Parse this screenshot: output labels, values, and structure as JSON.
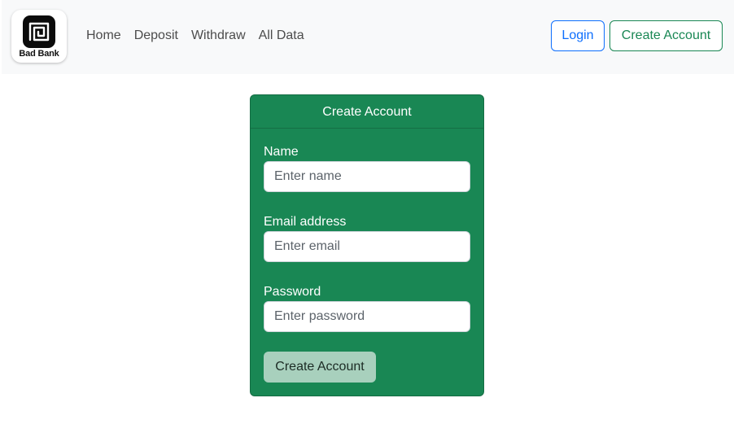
{
  "navbar": {
    "logo": {
      "text": "Bad Bank",
      "icon": "bank-logo-icon"
    },
    "links": [
      {
        "label": "Home"
      },
      {
        "label": "Deposit"
      },
      {
        "label": "Withdraw"
      },
      {
        "label": "All Data"
      }
    ],
    "login_label": "Login",
    "create_account_label": "Create Account"
  },
  "form": {
    "title": "Create Account",
    "fields": [
      {
        "label": "Name",
        "placeholder": "Enter name",
        "value": ""
      },
      {
        "label": "Email address",
        "placeholder": "Enter email",
        "value": ""
      },
      {
        "label": "Password",
        "placeholder": "Enter password",
        "value": ""
      }
    ],
    "submit_label": "Create Account"
  },
  "colors": {
    "primary": "#0d6efd",
    "success": "#198754",
    "navbar_bg": "#f8f9fa",
    "submit_bg": "#a8d0bd"
  }
}
